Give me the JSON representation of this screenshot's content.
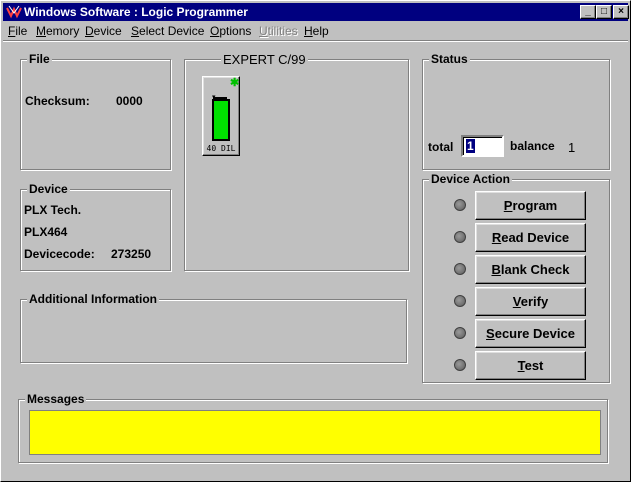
{
  "window": {
    "title": "Windows Software :  Logic Programmer",
    "min_glyph": "_",
    "max_glyph": "□",
    "close_glyph": "×"
  },
  "menu": {
    "items": [
      {
        "label": "File",
        "enabled": true
      },
      {
        "label": "Memory",
        "enabled": true
      },
      {
        "label": "Device",
        "enabled": true
      },
      {
        "label": "Select Device",
        "enabled": true
      },
      {
        "label": "Options",
        "enabled": true
      },
      {
        "label": "Utilities",
        "enabled": false
      },
      {
        "label": "Help",
        "enabled": true
      }
    ]
  },
  "file_group": {
    "label": "File",
    "checksum_label": "Checksum:",
    "checksum_value": "0000"
  },
  "programmer": {
    "label": "EXPERT  C/99",
    "chip_label": "40 DIL",
    "chip_color": "#00e000"
  },
  "status_group": {
    "label": "Status",
    "total_label": "total",
    "total_value": "1",
    "balance_label": "balance",
    "balance_value": "1"
  },
  "device_group": {
    "label": "Device",
    "manufacturer": "PLX Tech.",
    "part": "PLX464",
    "devicecode_label": "Devicecode:",
    "devicecode_value": "273250"
  },
  "device_action": {
    "label": "Device Action",
    "buttons": [
      {
        "label": "Program"
      },
      {
        "label": "Read Device"
      },
      {
        "label": "Blank Check"
      },
      {
        "label": "Verify"
      },
      {
        "label": "Secure Device"
      },
      {
        "label": "Test"
      }
    ]
  },
  "additional_info": {
    "label": "Additional Information"
  },
  "messages": {
    "label": "Messages",
    "background": "#ffff00",
    "text": ""
  },
  "colors": {
    "title_bar": "#000080",
    "face": "#c0c0c0"
  }
}
